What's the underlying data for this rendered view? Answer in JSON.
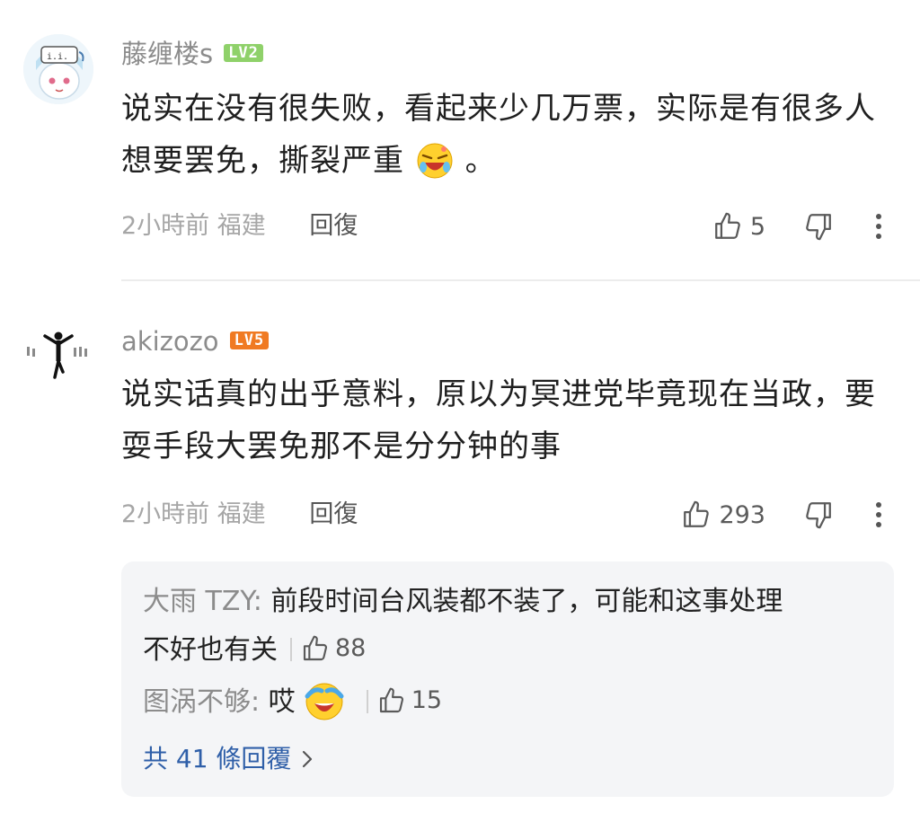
{
  "comments": [
    {
      "username": "藤缠楼s",
      "level": "LV2",
      "content_lines": [
        "说实在没有很失败，看起来少几万票，实际是有很多人",
        "想要罢免，撕裂严重"
      ],
      "content_tail": "。",
      "emoji": "laughing-tears-emoji",
      "time": "2小時前",
      "location": "福建",
      "reply_label": "回復",
      "likes": "5"
    },
    {
      "username": "akizozo",
      "level": "LV5",
      "content_lines": [
        "说实话真的出乎意料，原以为冥进党毕竟现在当政，要",
        "耍手段大罢免那不是分分钟的事"
      ],
      "time": "2小時前",
      "location": "福建",
      "reply_label": "回復",
      "likes": "293"
    }
  ],
  "replies": [
    {
      "author": "大雨 TZY:",
      "text_line1": "前段时间台风装都不装了，可能和这事处理",
      "text_line2": "不好也有关",
      "likes": "88"
    },
    {
      "author": "图涡不够:",
      "text": "哎",
      "emoji": "crying-emoji",
      "likes": "15"
    }
  ],
  "view_more": "共 41 條回覆",
  "icons": [
    "thumbs-up-icon",
    "thumbs-down-icon",
    "more-vertical-icon",
    "chevron-right-icon"
  ],
  "colors": {
    "lv2": "#8fd16a",
    "lv5": "#f07a22",
    "link": "#2f5fa8"
  }
}
